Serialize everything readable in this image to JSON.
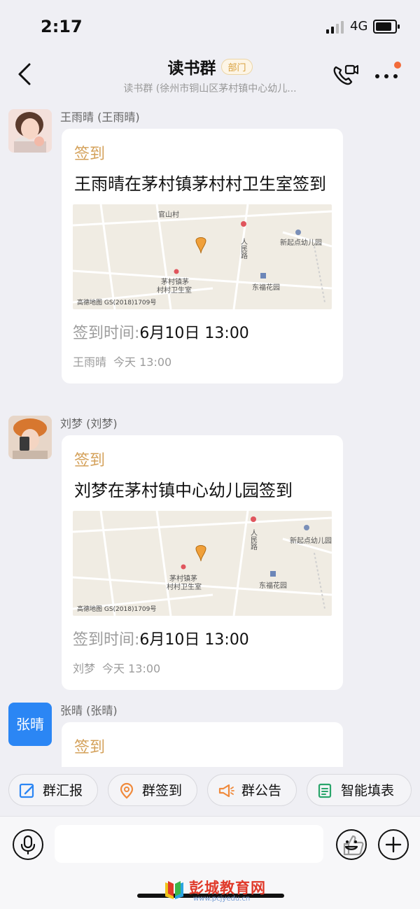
{
  "status_bar": {
    "time": "2:17",
    "network": "4G"
  },
  "header": {
    "title": "读书群",
    "badge": "部门",
    "subtitle": "读书群 (徐州市铜山区茅村镇中心幼儿..."
  },
  "messages": [
    {
      "sender": "王雨晴 (王雨晴)",
      "category": "签到",
      "title": "王雨晴在茅村镇茅村村卫生室签到",
      "time_label": "签到时间:",
      "time_value": "6月10日 13:00",
      "author": "王雨晴",
      "posted": "今天 13:00",
      "map": {
        "labels": [
          "官山村",
          "新起点幼儿园",
          "人民路",
          "茅村镇茅",
          "村村卫生室",
          "东福花园"
        ],
        "footer": "高德地图 GS(2018)1709号"
      }
    },
    {
      "sender": "刘梦 (刘梦)",
      "category": "签到",
      "title": "刘梦在茅村镇中心幼儿园签到",
      "time_label": "签到时间:",
      "time_value": "6月10日 13:00",
      "author": "刘梦",
      "posted": "今天 13:00",
      "map": {
        "labels": [
          "新起点幼儿园",
          "人民路",
          "茅村镇茅",
          "村村卫生室",
          "东福花园"
        ],
        "footer": "高德地图 GS(2018)1709号"
      }
    },
    {
      "sender": "张晴 (张晴)",
      "avatar_text": "张晴",
      "category": "签到"
    }
  ],
  "quick_actions": [
    {
      "label": "群汇报",
      "icon": "report-icon",
      "color": "#2b86f4"
    },
    {
      "label": "群签到",
      "icon": "location-icon",
      "color": "#f08a3c"
    },
    {
      "label": "群公告",
      "icon": "megaphone-icon",
      "color": "#f08a3c"
    },
    {
      "label": "智能填表",
      "icon": "form-icon",
      "color": "#2aa56b"
    }
  ],
  "watermark": {
    "text": "彭城教育网",
    "url": "www.pcjyedu.cn"
  }
}
